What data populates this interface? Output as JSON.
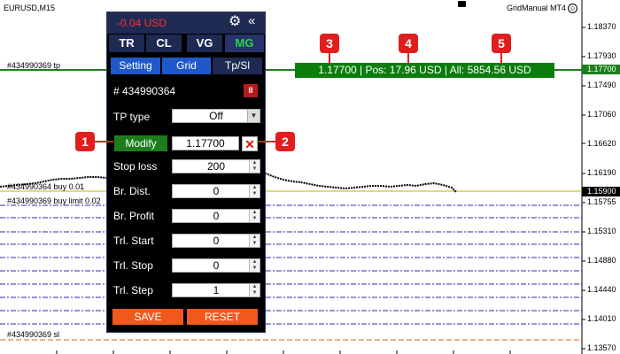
{
  "chart": {
    "symbol": "EURUSD,M15",
    "app_name": "GridManual MT4",
    "smile": "☺",
    "price_labels": [
      "1.18370",
      "1.17930",
      "1.17490",
      "1.17060",
      "1.16620",
      "1.16190",
      "1.15755",
      "1.15310",
      "1.14880",
      "1.14440",
      "1.14010",
      "1.13570"
    ],
    "tp_axis_tag": "1.17700",
    "current_axis_tag": "1.15900",
    "line_labels": {
      "tp": "#434990369 tp",
      "buy": "#434990364 buy 0.01",
      "buy_limit": "#434990369 buy limit 0.02",
      "sl": "#434990369 sl"
    },
    "colors": {
      "tp_line": "#1d7d1d",
      "grid_line": "#2b2bb0",
      "sl_line": "#d2691e",
      "current_price": "#b8b800"
    }
  },
  "tp_banner": "1.17700 | Pos: 17.96 USD | All: 5854.56 USD",
  "panel": {
    "pnl": "-0.04 USD",
    "gear_icon": "⚙",
    "collapse_icon": "«",
    "tabs": [
      {
        "label": "TR",
        "active": false
      },
      {
        "label": "CL",
        "active": false
      },
      {
        "label": "VG",
        "active": false
      },
      {
        "label": "MG",
        "active": true
      }
    ],
    "subtabs": [
      {
        "label": "Setting"
      },
      {
        "label": "Grid"
      },
      {
        "label": "Tp/Sl"
      }
    ],
    "order_id": "# 434990364",
    "pause_icon": "II",
    "tp_type_label": "TP type",
    "tp_type_value": "Off",
    "modify_label": "Modify",
    "price_value": "1.17700",
    "close_icon": "✕",
    "rows": [
      {
        "label": "Stop loss",
        "value": "200"
      },
      {
        "label": "Br. Dist.",
        "value": "0"
      },
      {
        "label": "Br. Profit",
        "value": "0"
      },
      {
        "label": "Trl. Start",
        "value": "0"
      },
      {
        "label": "Trl. Stop",
        "value": "0"
      },
      {
        "label": "Trl. Step",
        "value": "1"
      }
    ],
    "save_label": "SAVE",
    "reset_label": "RESET"
  },
  "callouts": [
    "1",
    "2",
    "3",
    "4",
    "5"
  ]
}
